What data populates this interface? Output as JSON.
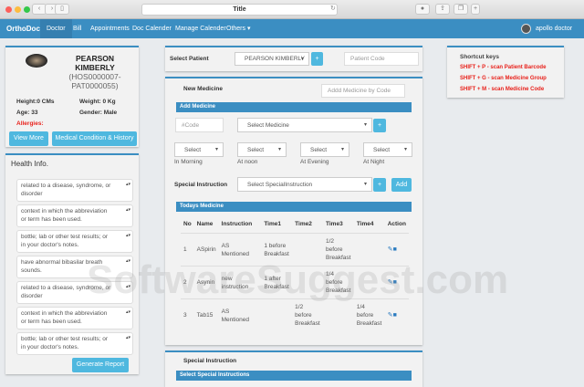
{
  "window": {
    "title": "Title"
  },
  "nav": {
    "brand": "OrthoDoc",
    "items": [
      "Doctor",
      "Bill",
      "Appointments",
      "Doc Calender",
      "Manage Calender",
      "Others"
    ],
    "user": "apollo doctor"
  },
  "patient": {
    "first": "PEARSON",
    "last": "KIMBERLY",
    "id1": "(HOS0000007-",
    "id2": "PAT0000055)",
    "height": "Height:0 CMs",
    "weight": "Weight: 0 Kg",
    "age": "Age: 33",
    "gender": "Gender: Male",
    "allergies": "Allergies:",
    "view_more": "View More",
    "history": "Medical Condition & History"
  },
  "health": {
    "title": "Health Info.",
    "notes": [
      [
        "related to a disease, syndrome, or",
        "disorder"
      ],
      [
        "context in which the abbreviation",
        "or term has been used."
      ],
      [
        "bottle; lab or other test results; or",
        "in your doctor's notes."
      ],
      [
        "have abnormal bibasilar breath",
        "sounds."
      ],
      [
        "related to a disease, syndrome, or",
        "disorder"
      ],
      [
        "context in which the abbreviation",
        "or term has been used."
      ],
      [
        "bottle; lab or other test results; or",
        "in your doctor's notes."
      ]
    ],
    "generate": "Generate Report"
  },
  "select_patient": {
    "label": "Select Patient",
    "value": "PEARSON KIMBERLY",
    "code_placeholder": "Patient Code",
    "plus": "+"
  },
  "medicine": {
    "title": "New Medicine",
    "code_search_placeholder": "Addd Medicine by Code",
    "add_bar": "Add Medicine",
    "code_placeholder": "#Code",
    "select_medicine": "Select Medicine",
    "plus": "+",
    "times": [
      {
        "value": "Select",
        "label": "In Morning"
      },
      {
        "value": "Select",
        "label": "At noon"
      },
      {
        "value": "Select",
        "label": "At Evening"
      },
      {
        "value": "Select",
        "label": "At Night"
      }
    ],
    "special_label": "Special Instruction",
    "special_select": "Select SpecialInstruction",
    "add": "Add"
  },
  "todays": {
    "title": "Todays Medicine",
    "headers": [
      "No",
      "Name",
      "Instruction",
      "Time1",
      "Time2",
      "Time3",
      "Time4",
      "Action"
    ],
    "rows": [
      [
        "1",
        "ASpirin",
        "AS Mentioned",
        "1 before Breakfast",
        "",
        "1/2 before Breakfast",
        ""
      ],
      [
        "2",
        "Asynin",
        "new instruction",
        "1 after Breakfast",
        "",
        "1/4 before Breakfast",
        ""
      ],
      [
        "3",
        "Tab15",
        "AS Mentioned",
        "",
        "1/2 before Breakfast",
        "",
        "1/4 before Breakfast"
      ]
    ]
  },
  "special": {
    "title": "Special Instruction",
    "bar": "Select Special Instructions"
  },
  "shortcuts": {
    "title": "Shortcut keys",
    "items": [
      "SHIFT + P - scan Patient Barcode",
      "SHIFT + G - scan Medicine Group",
      "SHIFT + M - scan Medicine Code"
    ]
  },
  "watermark": "SoftwareSuggest.com",
  "colors": {
    "primary": "#3b8ec2",
    "button": "#4fb8df",
    "alert": "#e8211b"
  }
}
